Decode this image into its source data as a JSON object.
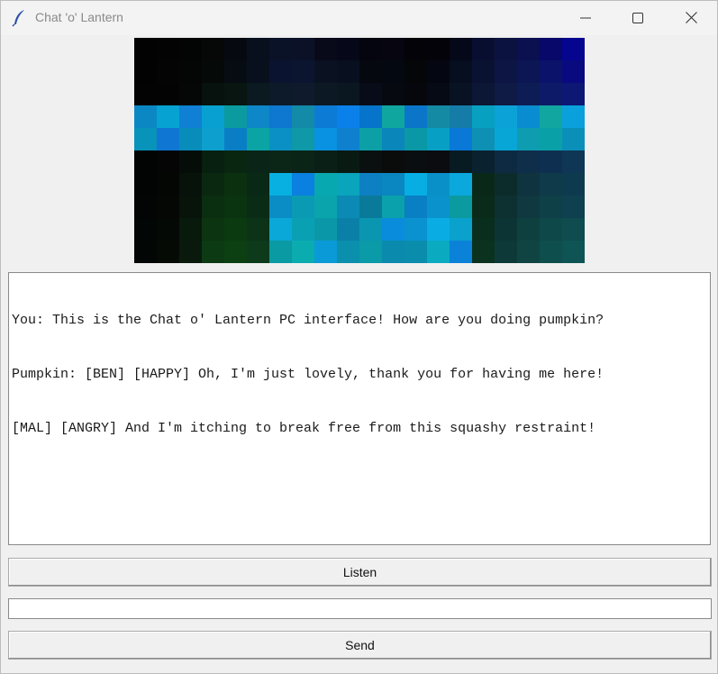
{
  "window": {
    "title": "Chat 'o' Lantern",
    "app_icon": "feather-icon",
    "controls": {
      "minimize": "minimize-icon",
      "maximize": "maximize-icon",
      "close": "close-icon"
    }
  },
  "face_canvas": {
    "cols": 20,
    "rows": 10,
    "pixels": [
      [
        "#020202",
        "#030303",
        "#020504",
        "#050807",
        "#060a10",
        "#08101e",
        "#0a1228",
        "#0b1228",
        "#080a1a",
        "#06081a",
        "#050510",
        "#060510",
        "#040408",
        "#030309",
        "#040818",
        "#080e30",
        "#0c1240",
        "#0a1050",
        "#08086a",
        "#050590"
      ],
      [
        "#020202",
        "#040404",
        "#040605",
        "#050907",
        "#060c12",
        "#08101e",
        "#0a1430",
        "#0c1530",
        "#0a1222",
        "#081020",
        "#060810",
        "#040810",
        "#040608",
        "#040612",
        "#060e20",
        "#0a1232",
        "#0d1545",
        "#0c1655",
        "#0b126a",
        "#0a0a80"
      ],
      [
        "#030303",
        "#030303",
        "#040705",
        "#07110d",
        "#081510",
        "#0a1a20",
        "#0c1a2a",
        "#0f1b2c",
        "#0c1824",
        "#0a1620",
        "#080c18",
        "#060a10",
        "#05070c",
        "#060a14",
        "#081222",
        "#0c1635",
        "#0f1a45",
        "#0e1c55",
        "#0c1a68",
        "#0c1874"
      ],
      [
        "#0b88c4",
        "#06a2d2",
        "#0f80d4",
        "#07a0d0",
        "#0b9a9f",
        "#0d87c7",
        "#0e77cf",
        "#138aa8",
        "#0c7bd6",
        "#0a81ea",
        "#0674ca",
        "#10a6a0",
        "#0b76c9",
        "#158aa4",
        "#157ca8",
        "#07a0c0",
        "#0ba2d8",
        "#0a8cd0",
        "#12a6a0",
        "#0aa0dc"
      ],
      [
        "#0893bb",
        "#0f76d4",
        "#088cb9",
        "#0da0cf",
        "#0a7ec4",
        "#0aa4a4",
        "#0a90c4",
        "#0e98a8",
        "#0992e2",
        "#0e80ce",
        "#0ca0a6",
        "#0b86bb",
        "#0a98a6",
        "#07a0c4",
        "#0978d6",
        "#0d90b4",
        "#07a6d6",
        "#0e9cb0",
        "#0aa0a8",
        "#0a8fb8"
      ],
      [
        "#020403",
        "#040504",
        "#060d08",
        "#08200f",
        "#082610",
        "#0b2418",
        "#0b2617",
        "#0a2418",
        "#0a2016",
        "#091a12",
        "#0a1010",
        "#0a0c0c",
        "#0a0e10",
        "#0a0c10",
        "#081a22",
        "#0a2130",
        "#0d2a42",
        "#0f2e4a",
        "#0f2f50",
        "#0f3654"
      ],
      [
        "#020403",
        "#040604",
        "#07120a",
        "#0a2810",
        "#0a3010",
        "#0a2816",
        "#07b0e0",
        "#0a80e0",
        "#08a8b0",
        "#0aa4bc",
        "#0d80c4",
        "#0a86c0",
        "#07aee4",
        "#0a90c8",
        "#0aa8dc",
        "#0a2818",
        "#0c2c2c",
        "#0f3440",
        "#0e3a4a",
        "#0e3a50"
      ],
      [
        "#020503",
        "#050704",
        "#08140a",
        "#0a2e10",
        "#0a3410",
        "#0a2c16",
        "#0a8cc4",
        "#0a9ab4",
        "#0aa4ac",
        "#0a8ab4",
        "#0a7a9a",
        "#0aa0ac",
        "#0a80c4",
        "#0a92cc",
        "#0a9aa0",
        "#0a2a1a",
        "#0d3030",
        "#0f3840",
        "#0e4048",
        "#0e4050"
      ],
      [
        "#020604",
        "#050905",
        "#081a0c",
        "#0c3410",
        "#0c3a10",
        "#0c3218",
        "#0aa8d8",
        "#0aa0b4",
        "#0a98a8",
        "#0a80a8",
        "#0a96b0",
        "#0a8cdc",
        "#0a92d0",
        "#0aace4",
        "#0aa2cc",
        "#0a2e1e",
        "#0d3434",
        "#0f4040",
        "#0e4848",
        "#0e4c50"
      ],
      [
        "#020604",
        "#060a05",
        "#091a0d",
        "#0c3a12",
        "#0c4012",
        "#0c3a1a",
        "#0a9aa4",
        "#0aacb0",
        "#0a9ad8",
        "#0a90ac",
        "#0a9aa8",
        "#0a8aac",
        "#0a8cac",
        "#0aaac0",
        "#0a82d8",
        "#0a321e",
        "#0d3a38",
        "#0f4442",
        "#0e4e4c",
        "#0e5454"
      ]
    ]
  },
  "chat_log": {
    "lines": [
      "You: This is the Chat o' Lantern PC interface! How are you doing pumpkin?",
      "Pumpkin: [BEN] [HAPPY] Oh, I'm just lovely, thank you for having me here!",
      "[MAL] [ANGRY] And I'm itching to break free from this squashy restraint!"
    ]
  },
  "controls": {
    "listen_label": "Listen",
    "message_input_value": "",
    "send_label": "Send"
  }
}
